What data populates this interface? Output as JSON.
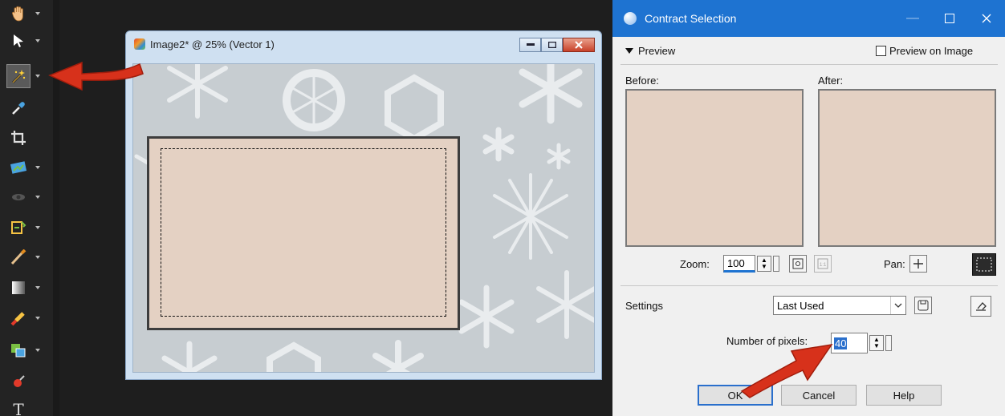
{
  "image_window": {
    "title": "Image2* @  25% (Vector 1)"
  },
  "dialog": {
    "title": "Contract Selection",
    "preview_section": "Preview",
    "preview_on_image_label": "Preview on Image",
    "before_label": "Before:",
    "after_label": "After:",
    "zoom_label": "Zoom:",
    "zoom_value": "100",
    "pan_label": "Pan:",
    "settings_label": "Settings",
    "settings_value": "Last Used",
    "pixels_label": "Number of pixels:",
    "pixels_value": "40",
    "ok_label": "OK",
    "cancel_label": "Cancel",
    "help_label": "Help"
  },
  "colors": {
    "selection_fill": "#e4d1c3",
    "dialog_title_bar": "#1e73d1",
    "arrow_red": "#d7311b"
  },
  "toolbar": {
    "tools": [
      "pan-tool-icon",
      "pick-tool-icon",
      "selection-tool-icon",
      "dropper-tool-icon",
      "crop-tool-icon",
      "move-tool-icon",
      "red-eye-tool-icon",
      "makeover-tool-icon",
      "paint-brush-icon",
      "eraser-icon",
      "retouch-icon",
      "clone-icon",
      "fill-icon",
      "text-tool-icon"
    ]
  }
}
